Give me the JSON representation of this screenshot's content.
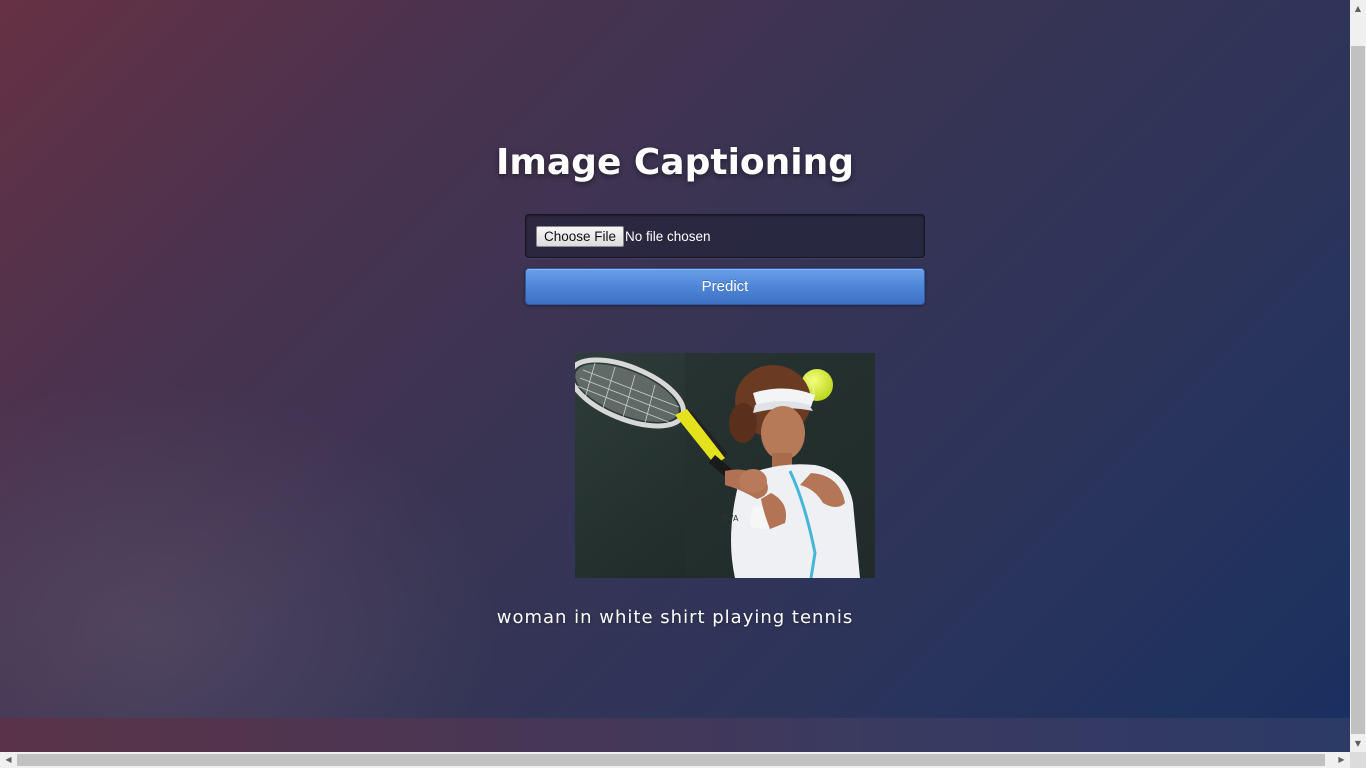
{
  "header": {
    "title": "Image Captioning"
  },
  "upload": {
    "choose_label": "Choose File",
    "status": "No file chosen"
  },
  "actions": {
    "predict_label": "Predict"
  },
  "result": {
    "caption": "woman in white shirt playing tennis"
  },
  "colors": {
    "predict_button": "#4f86d8",
    "title_text": "#ffffff",
    "background_left": "#6e3040",
    "background_right": "#1a3060"
  },
  "icons": {
    "scroll_up": "▲",
    "scroll_down": "▼",
    "scroll_left": "◀",
    "scroll_right": "▶"
  }
}
